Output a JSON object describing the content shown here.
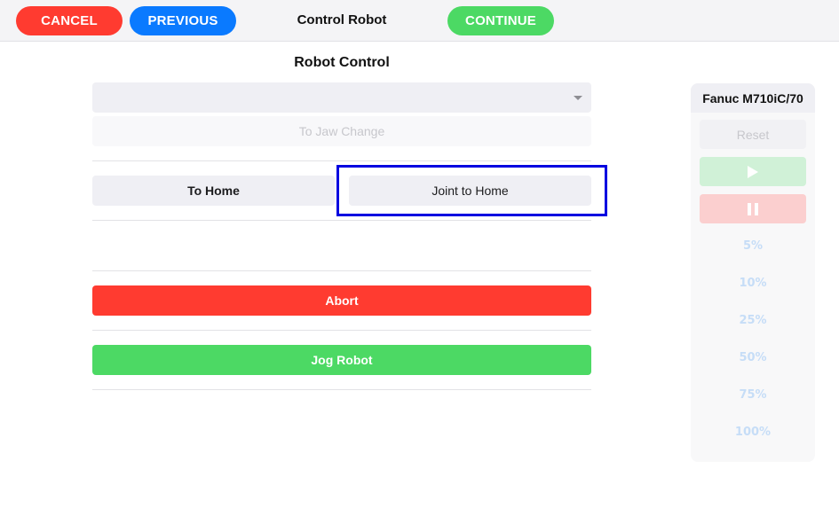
{
  "topbar": {
    "cancel_label": "CANCEL",
    "previous_label": "PREVIOUS",
    "title": "Control Robot",
    "continue_label": "CONTINUE"
  },
  "main": {
    "section_title": "Robot Control",
    "select_value": "",
    "jaw_change_label": "To Jaw Change",
    "to_home_label": "To Home",
    "joint_to_home_label": "Joint to Home",
    "abort_label": "Abort",
    "jog_robot_label": "Jog Robot"
  },
  "panel": {
    "robot_name": "Fanuc M710iC/70",
    "reset_label": "Reset",
    "play_icon": "play-icon",
    "pause_icon": "pause-icon",
    "speeds": [
      "5%",
      "10%",
      "25%",
      "50%",
      "75%",
      "100%"
    ]
  },
  "colors": {
    "danger": "#ff3b30",
    "primary": "#0a7aff",
    "success": "#4cd964",
    "highlight": "#0000e0"
  }
}
